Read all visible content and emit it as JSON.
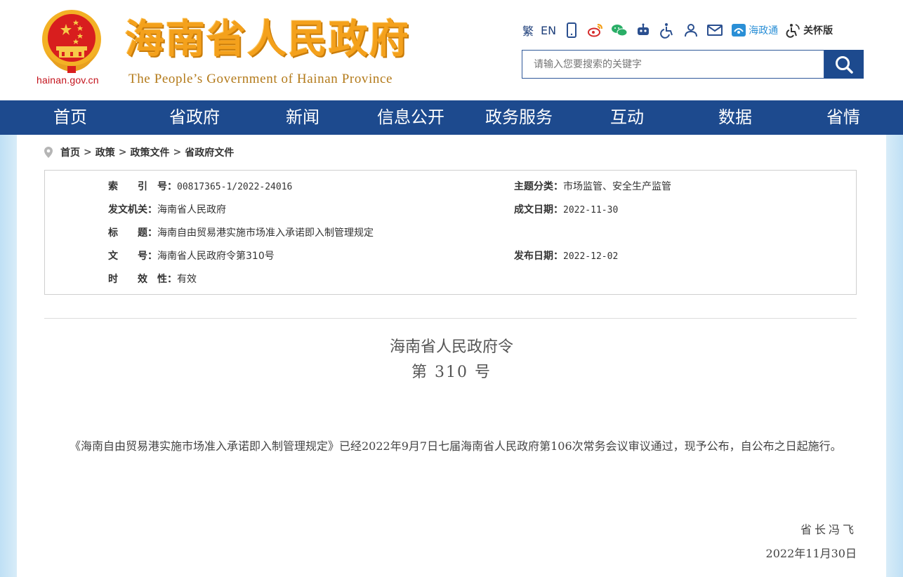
{
  "header": {
    "emblem": "national-emblem-icon",
    "domain": "hainan.gov.cn",
    "title": "海南省人民政府",
    "subtitle": "The People’s Government  of Hainan Province",
    "toolbar": {
      "traditional": "繁",
      "english": "EN",
      "mobile_icon": "mobile-icon",
      "weibo_icon": "weibo-icon",
      "wechat_icon": "wechat-icon",
      "robot_icon": "robot-icon",
      "accessibility_icon": "wheelchair-icon",
      "user_icon": "user-icon",
      "mail_icon": "mail-icon",
      "haizhengtong": "海政通",
      "care_mode": "关怀版"
    },
    "search": {
      "placeholder": "请输入您要搜索的关键字",
      "button_icon": "search-icon"
    }
  },
  "nav": {
    "items": [
      "首页",
      "省政府",
      "新闻",
      "信息公开",
      "政务服务",
      "互动",
      "数据",
      "省情"
    ]
  },
  "breadcrumb": {
    "items": [
      "首页",
      "政策",
      "政策文件",
      "省政府文件"
    ],
    "separator": ">"
  },
  "info": {
    "index_label": "索　　引　号：",
    "index_value": "00817365-1/2022-24016",
    "topic_label": "主题分类：",
    "topic_value": "市场监管、安全生产监管",
    "issuer_label": "发文机关：",
    "issuer_value": "海南省人民政府",
    "created_label": "成文日期：",
    "created_value": "2022-11-30",
    "title_label": "标　　题：",
    "title_value": "海南自由贸易港实施市场准入承诺即入制管理规定",
    "docno_label": "文　　号：",
    "docno_value": "海南省人民政府令第310号",
    "published_label": "发布日期：",
    "published_value": "2022-12-02",
    "validity_label": "时　　效　性：",
    "validity_value": "有效"
  },
  "document": {
    "heading": "海南省人民政府令",
    "number": "第 310 号",
    "body": "《海南自由贸易港实施市场准入承诺即入制管理规定》已经2022年9月7日七届海南省人民政府第106次常务会议审议通过，现予公布，自公布之日起施行。",
    "signature": "省长冯飞",
    "date": "2022年11月30日"
  },
  "colors": {
    "nav_bg": "#1d4a8e",
    "title_gold": "#f4a11c",
    "emblem_red": "#c3121b"
  }
}
